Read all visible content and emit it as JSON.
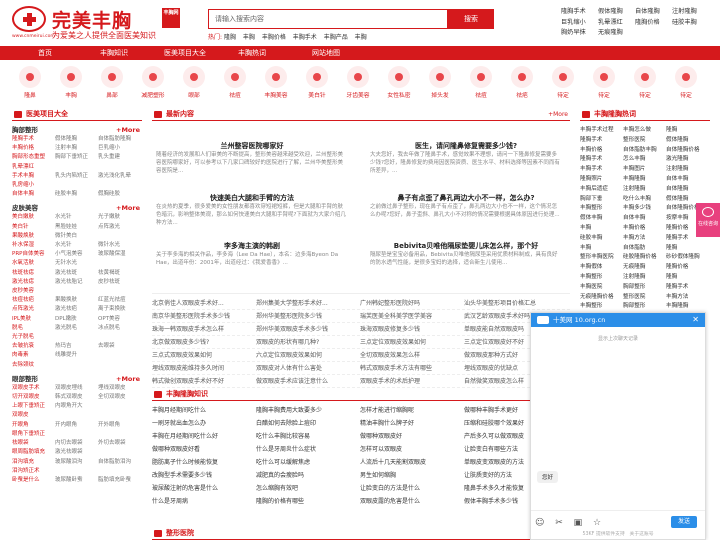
{
  "header": {
    "logo_text": "完美丰胸",
    "logo_badge": "丰胸网",
    "logo_url": "www.cnmeirui.com",
    "slogan": "为爱美之人提供全面医美知识",
    "search_placeholder": "请输入搜索内容",
    "search_button": "搜索",
    "hot_label": "热门:",
    "hot_items": [
      "隆胸",
      "丰胸",
      "丰胸价格",
      "丰胸手术",
      "丰胸产品",
      "丰胸"
    ],
    "top_links": [
      "隆胸手术",
      "假体隆胸",
      "自体隆胸",
      "注射隆胸",
      "巨乳缩小",
      "乳晕漂红",
      "隆胸价格",
      "硅胶丰胸",
      "胸奶早抹",
      "无痕隆胸"
    ]
  },
  "nav": [
    "首页",
    "丰胸知识",
    "医美项目大全",
    "丰胸热词",
    "网站地图"
  ],
  "icons": [
    "隆鼻",
    "丰胸",
    "鼻部",
    "减肥塑形",
    "眼部",
    "祛痘",
    "丰胸美容",
    "美白针",
    "牙齿美容",
    "女性私密",
    "掉头发",
    "祛痘",
    "祛疤",
    "待定",
    "待定",
    "待定",
    "待定"
  ],
  "left": {
    "title": "医美项目大全",
    "more": "+More",
    "blocks": [
      {
        "head": "胸部整形",
        "more": "+More",
        "dark": true,
        "rows": [
          [
            "隆胸手术",
            "假体隆胸",
            "自体脂肪隆胸"
          ],
          [
            "丰胸价格",
            "注射丰胸",
            "巨乳缩小"
          ],
          [
            "胸部形态重塑",
            "胸部下垂矫正",
            "乳头重建"
          ],
          [
            "乳晕漂红",
            "",
            " "
          ],
          [
            "手术丰胸",
            "乳头内陷矫正",
            "激光浅化乳晕"
          ],
          [
            "乳房缩小",
            "",
            ""
          ],
          [
            "自体丰胸",
            "硅胶丰胸",
            "假胸硅胶"
          ]
        ]
      },
      {
        "head": "皮肤美容",
        "more": "+More",
        "dark": true,
        "rows": [
          [
            "美白嫩肤",
            "水光针",
            "光子嫩肤"
          ],
          [
            "美白针",
            "黑脸娃娃",
            "点阵激光"
          ],
          [
            "果酸焕肤",
            "微针美白",
            ""
          ],
          [
            "补水保湿",
            "水光针",
            "微针水光"
          ],
          [
            "PRP自体美容",
            "小气泡美容",
            "玻尿酸保湿"
          ],
          [
            "水氧活肤",
            "无针水光",
            ""
          ],
          [
            "祛斑祛痣",
            "激光祛斑",
            "祛黄褐斑"
          ],
          [
            "激光祛痣",
            "激光祛胎记",
            "皮秒祛斑"
          ],
          [
            "皮秒美容",
            "",
            ""
          ],
          [
            "祛痘祛疤",
            "果酸换肤",
            "红蓝光祛痘"
          ],
          [
            "点阵激光",
            "激光祛疤",
            "离子束换肤"
          ],
          [
            "IPL美肤",
            "DPL嫩肤",
            "OPT美容"
          ],
          [
            "脱毛",
            "激光脱毛",
            "冰点脱毛"
          ],
          [
            "光子脱毛",
            "",
            ""
          ],
          [
            "去皱抗衰",
            "热玛吉",
            "去眼袋"
          ],
          [
            "肉毒素",
            "线雕提升",
            ""
          ],
          [
            "去除颈纹",
            "",
            ""
          ]
        ]
      },
      {
        "head": "眼部整形",
        "more": "+More",
        "dark": true,
        "rows": [
          [
            "双眼皮手术",
            "双眼皮埋线",
            "埋线双眼皮"
          ],
          [
            "切开双眼皮",
            "韩式双眼皮",
            "全切双眼皮"
          ],
          [
            "上眼下垂矫正",
            "内眼角开大",
            ""
          ],
          [
            "双眼皮",
            "",
            ""
          ],
          [
            "开眼角",
            "开内眼角",
            "开外眼角"
          ],
          [
            "眼角下垂矫正",
            "",
            ""
          ],
          [
            "祛眼袋",
            "内切去眼袋",
            "外切去眼袋"
          ],
          [
            "眼周脂肪填充",
            "激光祛眼袋",
            ""
          ],
          [
            "泪沟填充",
            "玻尿酸泪沟",
            "自体脂肪泪沟"
          ],
          [
            "泪沟矫正术",
            "",
            ""
          ],
          [
            "卧蚕是什么",
            "玻尿酸卧蚕",
            "脂肪填充卧蚕"
          ]
        ]
      }
    ]
  },
  "middle": {
    "title": "最新内容",
    "more": "+More",
    "news": [
      {
        "h": "兰州整容医院哪家好",
        "p": "随着经济的发展和人们审美的不断提高，整形美容越来越受欢迎，兰州整形美容医院哪家好，可以参考以下几家口碑较好的医院进行了解，兰州华美整形美容医院是..."
      },
      {
        "h": "医生，请问隆鼻修复需要多少钱?",
        "p": "大夫您好，我去年做了隆鼻手术，感觉效果不理想，请问一下隆鼻修复需要多少钱?您好，隆鼻修复的费用因医院资质、医生水平、材料选择等因素不同而有所差异，..."
      },
      {
        "h": "快速美白大腿和手臂的方法",
        "p": "在炎热的夏季，很多爱美的女性朋友都喜欢穿短裙短裤，但是大腿和手臂的肤色暗沉，影响整体美观，那么如何快速美白大腿和手臂呢?下面就为大家介绍几种方法..."
      },
      {
        "h": "鼻子有点歪了鼻孔两边大小不一样，怎么办?",
        "p": "之前做过鼻子整形，现在鼻子有点歪了，鼻孔两边大小也不一样，这个情况怎么办呢?您好，鼻子歪斜、鼻孔大小不对称的情况需要根据具体原因进行处理..."
      },
      {
        "h": "李多海主演的韩剧",
        "p": "关于李多海的相关作品，李多海（Lee Da Hae），本名：边多海Byeon Da Hae，出道年份：2001年，出道经过：《我爱香香》..."
      },
      {
        "h": "Bebivita贝唯他隔尿垫婴儿床怎么样，那个好",
        "p": "隔尿垫是宝宝必备用品，Bebivita贝唯他隔尿垫采用优质材料制成，具有良好的防水透气性能，是很多宝妈的选择，适合新生儿使用..."
      }
    ],
    "list": [
      [
        "北京俏佳人双眼皮手术好...",
        "郑州集美大学整形手术好...",
        "广州韩妃整形医院好吗",
        "汕头华美整形项目价格汇总"
      ],
      [
        "南京华美整形医院手术多少钱",
        "郑州华美整形医院多少钱",
        "瑞芙医美全科美学医学美容",
        "武汉艺龄双眼皮手术好吗"
      ],
      [
        "珠海一韩双眼皮手术怎么样",
        "郑州华美双眼皮手术多少钱",
        "珠海双眼皮修复多少钱",
        "单眼皮能自然双眼皮吗"
      ],
      [
        "北京做双眼皮多少钱?",
        "双眼皮的形状有哪几种?",
        "三点定位双眼皮效果如何",
        "三点定位双眼皮好不好"
      ],
      [
        "三点式双眼皮效果如何",
        "六点定位双眼皮效果如何",
        "全切双眼皮效果怎么样",
        "做双眼皮那种方式好"
      ],
      [
        "埋线双眼皮能维持多久时间",
        "双眼皮对人体有什么害处",
        "韩式双眼皮手术方法有哪些",
        "埋线双眼皮的优缺点"
      ],
      [
        "韩式微创双眼皮手术好不好",
        "做双眼皮手术应该注意什么",
        "双眼皮手术的术后护理",
        "自然微笑双眼皮怎么样"
      ]
    ]
  },
  "section2": {
    "title": "丰胸隆胸知识",
    "rows": [
      [
        "丰胸月经期间吃什么",
        "隆胸丰胸费用大致要多少",
        "怎样才能进行缩胸呢",
        "做哪种丰胸手术更好"
      ],
      [
        "一刷牙就出血怎么办",
        "白醋如何去除脸上痘印",
        "精油丰胸什么牌子好",
        "压缩和硅胶哪个效果好"
      ],
      [
        "丰胸在月经期间吃什么好",
        "吃什么丰胸比较容易",
        "做哪种双眼皮好",
        "产后多久可以做双眼皮"
      ],
      [
        "做哪种双眼皮好看",
        "什么是牙周炎什么症状",
        "怎样可以双眼皮",
        "让脸变白有哪些方法"
      ],
      [
        "脂肪离子什么时候能恢复",
        "吃什么可以缓解焦虑",
        "人流后十几天能割双眼皮",
        "单眼皮变双眼皮的方法"
      ],
      [
        "改胸型手术需要多少钱",
        "减肥真的会瘦脸吗",
        "男生如何缩胸",
        "让肤质变好的方法"
      ],
      [
        "玻尿酸注射的危害是什么",
        "怎么缩胸有效吧",
        "让脸变白的方法是什么",
        "隆鼻手术多久才能恢复"
      ],
      [
        "什么是牙周病",
        "隆胸的价格有哪些",
        "双眼皮露的危害是什么",
        "假体丰胸手术多少钱"
      ]
    ]
  },
  "section3": {
    "title": "整形医院"
  },
  "right": {
    "title": "丰胸隆胸热词",
    "more": "+More",
    "rows": [
      [
        "丰胸手术过程",
        "丰胸怎么做",
        "隆胸"
      ],
      [
        "隆胸手术",
        "整形医院",
        "假体隆胸"
      ],
      [
        "丰胸价格",
        "自体脂肪丰胸",
        "自体隆胸价格"
      ],
      [
        "隆胸手术",
        "怎么丰胸",
        "激光隆胸"
      ],
      [
        "丰胸手术",
        "丰胸图片",
        "注射隆胸"
      ],
      [
        "隆胸照片",
        "丰胸隆胸",
        "自体丰胸"
      ],
      [
        "丰胸后遗症",
        "注射隆胸",
        "自体隆胸"
      ],
      [
        "胸部下垂",
        "吃什么丰胸",
        "假体隆胸"
      ],
      [
        "丰胸整形",
        "丰胸多少钱",
        "自体隆胸价格"
      ],
      [
        "假体丰胸",
        "自体丰胸",
        "按摩丰胸"
      ],
      [
        "丰胸",
        "丰胸价格",
        "隆胸价格"
      ],
      [
        "硅胶丰胸",
        "丰胸方法",
        "隆胸手术"
      ],
      [
        "丰胸",
        "自体脂肪",
        "隆胸"
      ],
      [
        "整形丰胸医院",
        "硅胶隆胸价格",
        "砂砂假体隆胸"
      ],
      [
        "丰胸假体",
        "无痕隆胸",
        "隆胸价格"
      ],
      [
        "丰胸整形",
        "注射隆胸",
        "隆胸"
      ],
      [
        "丰胸医院",
        "胸部整形",
        "隆胸手术"
      ],
      [
        "无痕隆胸价格",
        "整形医院",
        "丰胸方法"
      ],
      [
        "丰胸整形",
        "胸部整形",
        "丰胸隆胸"
      ],
      [
        "韩式假体隆胸",
        "砂砂假体隆胸",
        "丰胸价格"
      ],
      [
        "丰胸(丰胸)",
        "安全的隆胸",
        "正规隆胸医院"
      ],
      [
        "丰胸",
        "胸部整形",
        "隆胸产品"
      ],
      [
        "丰胸价格",
        "自体隆胸",
        "隆胸技术"
      ],
      [
        "丰胸",
        "激光隆胸",
        "丰胸"
      ]
    ]
  },
  "chat": {
    "title": "十美网 10.org.cn",
    "close": "✕",
    "note": "显示上次聊天记录",
    "message": "您好",
    "tools": "☺ ✂ ▣ ☆",
    "send": "发送",
    "footer": "53KF 提供软件支持　关于这账号"
  },
  "online": {
    "label": "在线咨询"
  }
}
